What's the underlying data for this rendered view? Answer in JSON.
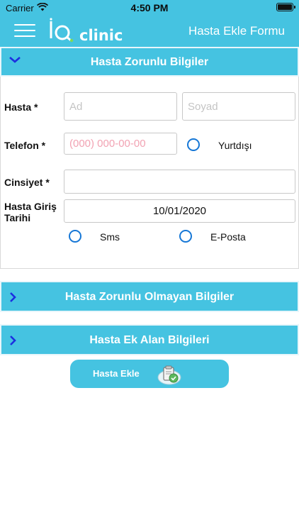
{
  "status_bar": {
    "carrier": "Carrier",
    "time": "4:50 PM"
  },
  "nav": {
    "title": "Hasta Ekle Formu",
    "logo_text": "clinic",
    "logo_mark": "IQ"
  },
  "sections": {
    "required": {
      "title": "Hasta Zorunlu Bilgiler",
      "expanded": true
    },
    "optional": {
      "title": "Hasta Zorunlu Olmayan Bilgiler",
      "expanded": false
    },
    "extra": {
      "title": "Hasta Ek Alan Bilgileri",
      "expanded": false
    }
  },
  "form": {
    "hasta_label": "Hasta *",
    "ad_placeholder": "Ad",
    "soyad_placeholder": "Soyad",
    "telefon_label": "Telefon *",
    "telefon_placeholder": "(000) 000-00-00",
    "yurtdisi_label": "Yurtdışı",
    "cinsiyet_label": "Cinsiyet *",
    "cinsiyet_value": "",
    "giris_label": "Hasta Giriş Tarihi",
    "giris_value": "10/01/2020",
    "sms_label": "Sms",
    "eposta_label": "E-Posta"
  },
  "submit": {
    "label": "Hasta Ekle",
    "icon": "add-patient-icon"
  },
  "colors": {
    "accent": "#45c3e1",
    "radio": "#1677d6",
    "chevron": "#1c2fe0"
  }
}
